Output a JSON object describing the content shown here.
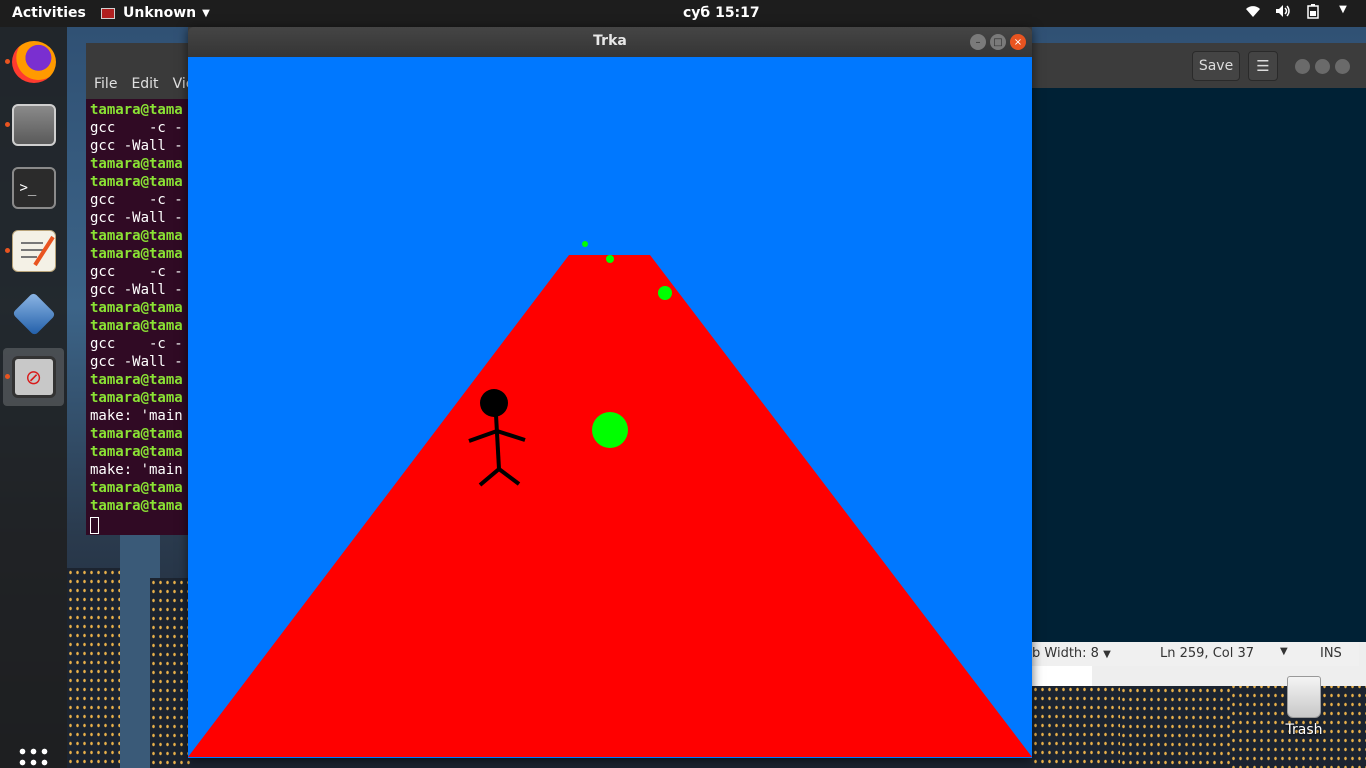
{
  "topbar": {
    "activities": "Activities",
    "app_name": "Unknown",
    "clock": "суб 15:17",
    "tray_icons": [
      "wifi-icon",
      "volume-icon",
      "battery-icon",
      "power-menu-icon"
    ]
  },
  "dock": {
    "items": [
      "firefox",
      "files",
      "terminal",
      "text-editor",
      "virtualbox",
      "unknown-app"
    ],
    "running": [
      "firefox",
      "files",
      "text-editor",
      "unknown-app"
    ],
    "active": "unknown-app"
  },
  "terminal": {
    "menu": [
      "File",
      "Edit",
      "Vie"
    ],
    "lines": [
      {
        "text": "tamara@tama",
        "type": "prompt"
      },
      {
        "text": "gcc    -c -",
        "type": "out"
      },
      {
        "text": "gcc -Wall -",
        "type": "out"
      },
      {
        "text": "tamara@tama",
        "type": "prompt"
      },
      {
        "text": "tamara@tama",
        "type": "prompt"
      },
      {
        "text": "gcc    -c -",
        "type": "out"
      },
      {
        "text": "gcc -Wall -",
        "type": "out"
      },
      {
        "text": "tamara@tama",
        "type": "prompt"
      },
      {
        "text": "tamara@tama",
        "type": "prompt"
      },
      {
        "text": "gcc    -c -",
        "type": "out"
      },
      {
        "text": "gcc -Wall -",
        "type": "out"
      },
      {
        "text": "tamara@tama",
        "type": "prompt"
      },
      {
        "text": "tamara@tama",
        "type": "prompt"
      },
      {
        "text": "gcc    -c -",
        "type": "out"
      },
      {
        "text": "gcc -Wall -",
        "type": "out"
      },
      {
        "text": "tamara@tama",
        "type": "prompt"
      },
      {
        "text": "tamara@tama",
        "type": "prompt"
      },
      {
        "text": "make: 'main",
        "type": "out"
      },
      {
        "text": "tamara@tama",
        "type": "prompt"
      },
      {
        "text": "tamara@tama",
        "type": "prompt"
      },
      {
        "text": "make: 'main",
        "type": "out"
      },
      {
        "text": "tamara@tama",
        "type": "prompt"
      },
      {
        "text": "tamara@tama",
        "type": "prompt"
      }
    ]
  },
  "gedit": {
    "save_label": "Save",
    "menu_label": "☰",
    "tab_width": "b Width: 8",
    "position": "Ln 259, Col 37",
    "mode": "INS"
  },
  "desktop": {
    "trash_label": "Trash"
  },
  "game": {
    "title": "Trka",
    "colors": {
      "sky": "#0078ff",
      "road": "#ff0000",
      "ball": "#00ff00",
      "player": "#000000"
    }
  }
}
